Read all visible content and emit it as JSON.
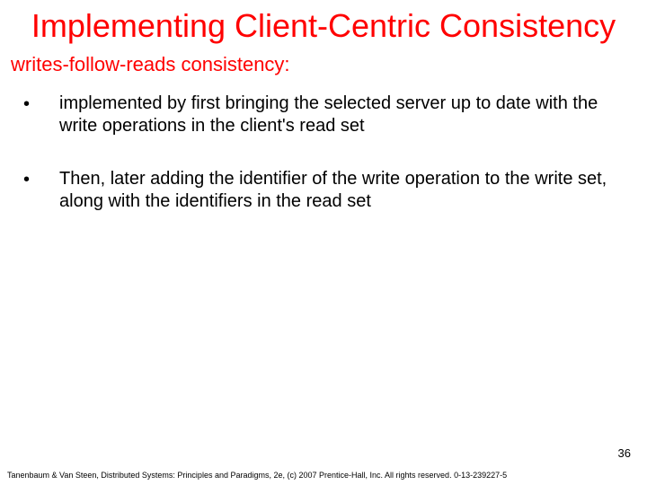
{
  "title": "Implementing Client-Centric Consistency",
  "subtitle": "writes-follow-reads consistency:",
  "bullets": [
    {
      "marker": "•",
      "text": "implemented by first bringing the selected server up to date with the write operations in the client's read set"
    },
    {
      "marker": "•",
      "text": "Then, later adding the identifier of the write operation to the write set, along with the identifiers in the read set"
    }
  ],
  "page_number": "36",
  "footer": "Tanenbaum & Van Steen, Distributed Systems: Principles and Paradigms, 2e, (c) 2007 Prentice-Hall, Inc. All rights reserved. 0-13-239227-5"
}
